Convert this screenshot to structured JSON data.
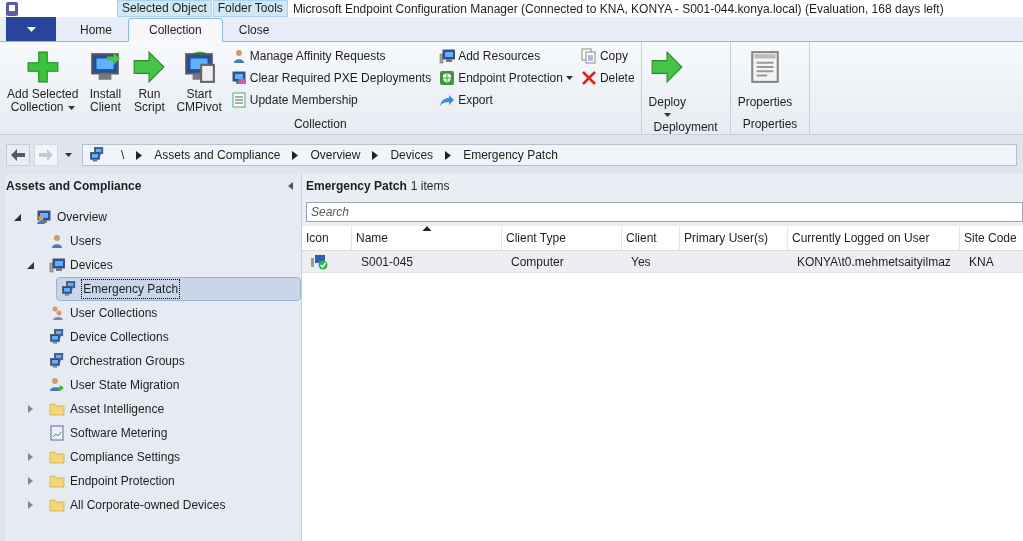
{
  "title_bar": {
    "context_tabs": [
      "Selected Object",
      "Folder Tools"
    ],
    "title": "Microsoft Endpoint Configuration Manager (Connected to KNA, KONYA - S001-044.konya.local) (Evaluation, 168 days left)"
  },
  "tabs": [
    {
      "label": "Home",
      "selected": false
    },
    {
      "label": "Collection",
      "selected": true
    },
    {
      "label": "Close",
      "selected": false
    }
  ],
  "ribbon": [
    {
      "label": "Collection",
      "columns": [
        [
          {
            "kind": "large",
            "label": [
              "Add Selected",
              "Collection"
            ],
            "dropdown": true
          }
        ],
        [
          {
            "kind": "large",
            "label": [
              "Install",
              "Client"
            ],
            "dropdown": false
          }
        ],
        [
          {
            "kind": "large",
            "label": [
              "Run",
              "Script"
            ],
            "dropdown": false
          }
        ],
        [
          {
            "kind": "large",
            "label": [
              "Start",
              "CMPivot"
            ],
            "dropdown": false
          }
        ],
        [
          {
            "kind": "small",
            "label": [
              "Manage Affinity Requests"
            ],
            "dropdown": false
          },
          {
            "kind": "small",
            "label": [
              "Clear Required PXE Deployments"
            ],
            "dropdown": false
          },
          {
            "kind": "small",
            "label": [
              "Update Membership"
            ],
            "dropdown": false
          }
        ],
        [
          {
            "kind": "small",
            "label": [
              "Add Resources"
            ],
            "dropdown": false
          },
          {
            "kind": "small",
            "label": [
              "Endpoint Protection"
            ],
            "dropdown": true
          },
          {
            "kind": "small",
            "label": [
              "Export"
            ],
            "dropdown": false
          }
        ],
        [
          {
            "kind": "small",
            "label": [
              "Copy"
            ],
            "dropdown": false
          },
          {
            "kind": "small",
            "label": [
              "Delete"
            ],
            "dropdown": false
          }
        ]
      ]
    },
    {
      "label": "Deployment",
      "columns": [
        [
          {
            "kind": "large",
            "label": [
              "Deploy"
            ],
            "dropdown": true
          }
        ]
      ]
    },
    {
      "label": "Properties",
      "columns": [
        [
          {
            "kind": "large",
            "label": [
              "Properties"
            ],
            "dropdown": false
          }
        ]
      ]
    }
  ],
  "address_bar": {
    "root": "\\",
    "path": [
      "Assets and Compliance",
      "Overview",
      "Devices",
      "Emergency Patch"
    ]
  },
  "sidebar": {
    "title": "Assets and Compliance",
    "tree": [
      {
        "label": "Overview",
        "expanded": true,
        "selected": false,
        "children": [
          {
            "label": "Users",
            "selected": false
          },
          {
            "label": "Devices",
            "expanded": true,
            "selected": false,
            "children": [
              {
                "label": "Emergency Patch",
                "selected": true
              }
            ]
          },
          {
            "label": "User Collections",
            "selected": false
          },
          {
            "label": "Device Collections",
            "selected": false
          },
          {
            "label": "Orchestration Groups",
            "selected": false
          },
          {
            "label": "User State Migration",
            "selected": false
          },
          {
            "label": "Asset Intelligence",
            "expanded": false,
            "selected": false
          },
          {
            "label": "Software Metering",
            "selected": false
          },
          {
            "label": "Compliance Settings",
            "expanded": false,
            "selected": false
          },
          {
            "label": "Endpoint Protection",
            "expanded": false,
            "selected": false
          },
          {
            "label": "All Corporate-owned Devices",
            "expanded": false,
            "selected": false
          }
        ]
      }
    ]
  },
  "content": {
    "title": "Emergency Patch",
    "count": "1 items",
    "search": {
      "placeholder": "Search"
    },
    "table": {
      "columns": [
        {
          "label": "Icon",
          "sorted": false
        },
        {
          "label": "Name",
          "sorted": true
        },
        {
          "label": "Client Type",
          "sorted": false
        },
        {
          "label": "Client",
          "sorted": false
        },
        {
          "label": "Primary User(s)",
          "sorted": false
        },
        {
          "label": "Currently Logged on User",
          "sorted": false
        },
        {
          "label": "Site Code",
          "sorted": false
        }
      ],
      "rows": [
        {
          "selected": true,
          "cells": [
            "",
            "S001-045",
            "Computer",
            "Yes",
            "",
            "KONYA\\t0.mehmetsaityilmaz",
            "KNA"
          ]
        }
      ]
    }
  }
}
